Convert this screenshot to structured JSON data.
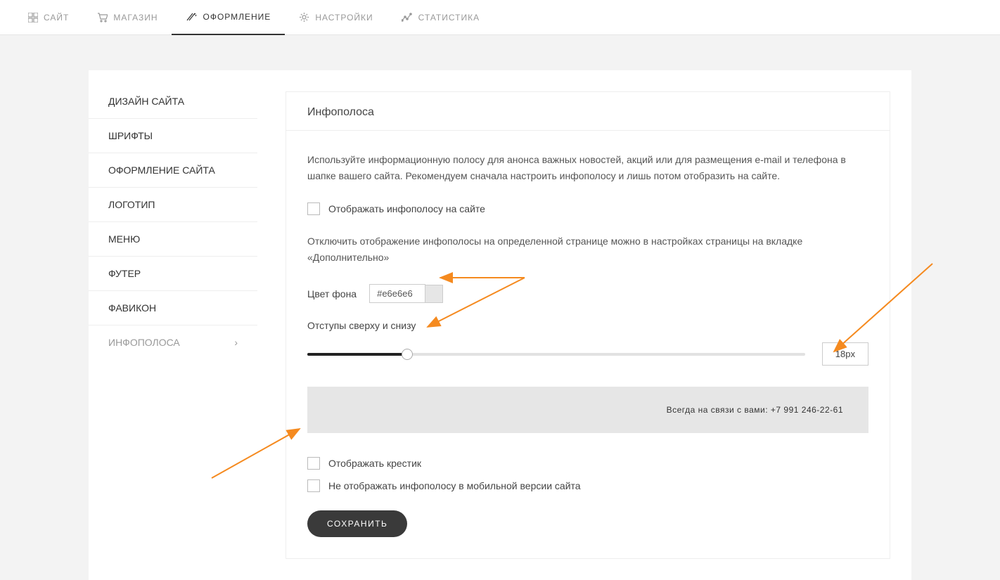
{
  "header": {
    "nav": [
      {
        "label": "САЙТ",
        "icon": "grid-icon",
        "active": false
      },
      {
        "label": "МАГАЗИН",
        "icon": "cart-icon",
        "active": false
      },
      {
        "label": "ОФОРМЛЕНИЕ",
        "icon": "design-icon",
        "active": true
      },
      {
        "label": "НАСТРОЙКИ",
        "icon": "gear-icon",
        "active": false
      },
      {
        "label": "СТАТИСТИКА",
        "icon": "stats-icon",
        "active": false
      }
    ]
  },
  "sidebar": {
    "items": [
      {
        "label": "ДИЗАЙН САЙТА",
        "active": false
      },
      {
        "label": "ШРИФТЫ",
        "active": false
      },
      {
        "label": "ОФОРМЛЕНИЕ САЙТА",
        "active": false
      },
      {
        "label": "ЛОГОТИП",
        "active": false
      },
      {
        "label": "МЕНЮ",
        "active": false
      },
      {
        "label": "ФУТЕР",
        "active": false
      },
      {
        "label": "ФАВИКОН",
        "active": false
      },
      {
        "label": "ИНФОПОЛОСА",
        "active": true
      }
    ]
  },
  "main": {
    "title": "Инфополоса",
    "description": "Используйте информационную полосу для анонса важных новостей, акций или для размещения e-mail и телефона в шапке вашего сайта. Рекомендуем сначала настроить инфополосу и лишь потом отобразить на сайте.",
    "checkbox_show": "Отображать инфополосу на сайте",
    "note": "Отключить отображение инфополосы на определенной странице можно в настройках страницы на вкладке «Дополнительно»",
    "bg_color_label": "Цвет фона",
    "bg_color_value": "#e6e6e6",
    "padding_label": "Отступы сверху и снизу",
    "padding_value": "18px",
    "preview_text": "Всегда на связи с вами: +7 991 246-22-61",
    "checkbox_cross": "Отображать крестик",
    "checkbox_mobile": "Не отображать инфополосу в мобильной версии сайта",
    "save_label": "СОХРАНИТЬ"
  }
}
